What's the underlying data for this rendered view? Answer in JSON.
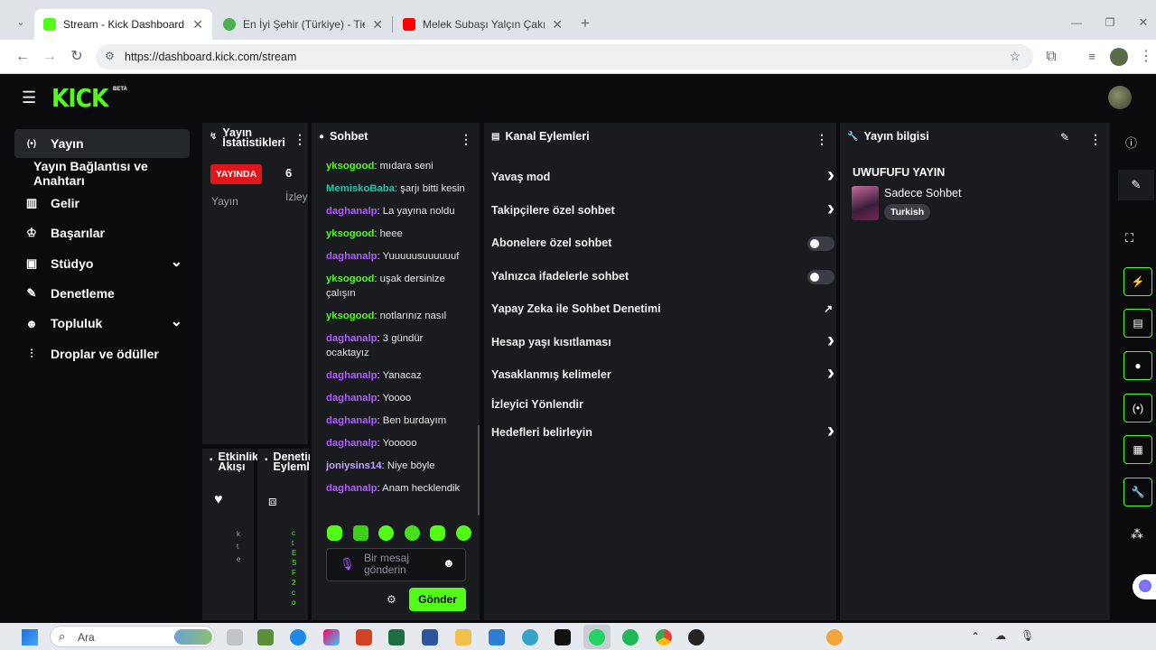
{
  "browser": {
    "tabs": [
      {
        "title": "Stream - Kick Dashboard",
        "active": true,
        "favicon_color": "#53fc18"
      },
      {
        "title": "En İyi Şehir (Türkiye) - Tier List,",
        "active": false,
        "favicon_color": "#4caf50"
      },
      {
        "title": "Melek Subaşı Yalçın Çakır Doğu",
        "active": false,
        "favicon_color": "#ff0000"
      }
    ],
    "url": "https://dashboard.kick.com/stream"
  },
  "brand": {
    "logo": "KICK",
    "beta": "BETA",
    "accent": "#53fc18"
  },
  "sidebar": {
    "items": [
      {
        "label": "Yayın",
        "icon": "broadcast-icon",
        "glyph": "(•)",
        "active": true
      },
      {
        "label": "Yayın Bağlantısı ve Anahtarı",
        "icon": "",
        "glyph": "",
        "active": false
      },
      {
        "label": "Gelir",
        "icon": "chart-icon",
        "glyph": "▥",
        "active": false
      },
      {
        "label": "Başarılar",
        "icon": "trophy-icon",
        "glyph": "🏆",
        "active": false
      },
      {
        "label": "Stüdyo",
        "icon": "studio-icon",
        "glyph": "▣",
        "active": false,
        "expand": "⌄"
      },
      {
        "label": "Denetleme",
        "icon": "wrench-icon",
        "glyph": "🔧",
        "active": false
      },
      {
        "label": "Topluluk",
        "icon": "community-icon",
        "glyph": "👥",
        "active": false,
        "expand": "⌄"
      },
      {
        "label": "Droplar ve ödüller",
        "icon": "drops-icon",
        "glyph": "⫶",
        "active": false
      }
    ]
  },
  "stats": {
    "title": "Yayın İstatistikleri",
    "live_badge": "YAYINDA",
    "viewer_count": "6",
    "col1": "Yayın",
    "col2": "İzley"
  },
  "events": {
    "title": "Etkinlik Akışı",
    "side_text": "kte"
  },
  "moderation": {
    "title": "Denetim Eylemleri",
    "side_text": "c t E S F 2 c o"
  },
  "chat": {
    "title": "Sohbet",
    "messages": [
      {
        "user": "yksogood",
        "text": "mıdara seni",
        "color": "#53fc18"
      },
      {
        "user": "MemiskoBaba",
        "text": "şarjı bitti kesin",
        "color": "#1ec9a4"
      },
      {
        "user": "daghanalp",
        "text": "La yayına noldu",
        "color": "#b05cff"
      },
      {
        "user": "yksogood",
        "text": "heee",
        "color": "#53fc18"
      },
      {
        "user": "daghanalp",
        "text": "Yuuuuusuuuuuuf",
        "color": "#b05cff"
      },
      {
        "user": "yksogood",
        "text": "uşak dersinize çalışın",
        "color": "#53fc18"
      },
      {
        "user": "yksogood",
        "text": "notlarınız nasıl",
        "color": "#53fc18"
      },
      {
        "user": "daghanalp",
        "text": "3 gündür ocaktayız",
        "color": "#b05cff"
      },
      {
        "user": "daghanalp",
        "text": "Yanacaz",
        "color": "#b05cff"
      },
      {
        "user": "daghanalp",
        "text": "Yoooo",
        "color": "#b05cff"
      },
      {
        "user": "daghanalp",
        "text": "Ben burdayım",
        "color": "#b05cff"
      },
      {
        "user": "daghanalp",
        "text": "Yooooo",
        "color": "#b05cff"
      },
      {
        "user": "joniysins14",
        "text": "Niye böyle",
        "color": "#c8a2ff"
      },
      {
        "user": "daghanalp",
        "text": "Anam hecklendik",
        "color": "#b05cff"
      }
    ],
    "placeholder": "Bir mesaj gönderin",
    "send_label": "Gönder"
  },
  "channel_actions": {
    "title": "Kanal Eylemleri",
    "rows": [
      {
        "label": "Yavaş mod",
        "control": "chevron"
      },
      {
        "label": "Takipçilere özel sohbet",
        "control": "chevron"
      },
      {
        "label": "Abonelere özel sohbet",
        "control": "toggle"
      },
      {
        "label": "Yalnızca ifadelerle sohbet",
        "control": "toggle"
      },
      {
        "label": "Yapay Zeka ile Sohbet Denetimi",
        "control": "external"
      },
      {
        "label": "Hesap yaşı kısıtlaması",
        "control": "chevron"
      },
      {
        "label": "Yasaklanmış kelimeler",
        "control": "chevron"
      },
      {
        "label": "İzleyici Yönlendir",
        "control": "none"
      },
      {
        "label": "Hedefleri belirleyin",
        "control": "chevron"
      }
    ]
  },
  "stream_info": {
    "title": "Yayın bilgisi",
    "stream_title": "UWUFUFU YAYIN",
    "category": "Sadece Sohbet",
    "language": "Turkish"
  },
  "taskbar": {
    "search": "Ara"
  }
}
